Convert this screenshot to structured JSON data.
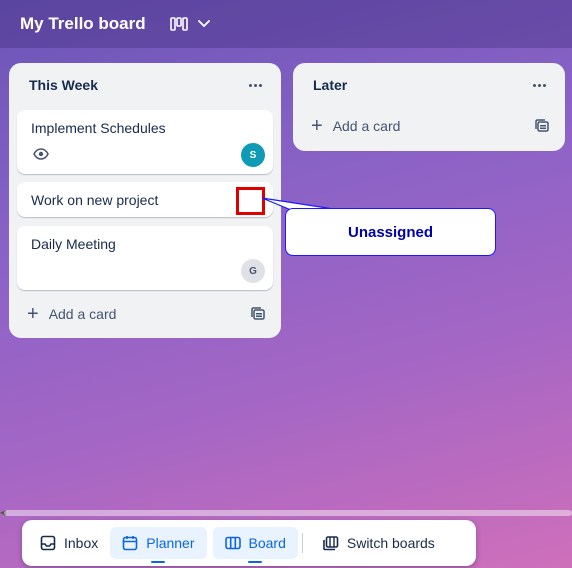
{
  "board": {
    "title": "My Trello board",
    "view_icon": "board-view-icon",
    "dropdown_icon": "chevron-down-icon"
  },
  "lists": [
    {
      "title": "This Week",
      "menu_icon": "ellipsis-icon",
      "cards": [
        {
          "title": "Implement Schedules",
          "badge_icon": "eye-icon",
          "member_initial": "S",
          "member_color": "#0f9ab5"
        },
        {
          "title": "Work on new project"
        },
        {
          "title": "Daily Meeting",
          "member_initial": "G",
          "member_color": "#dfe1e6"
        }
      ],
      "add_card_label": "Add a card",
      "template_icon": "card-template-icon"
    },
    {
      "title": "Later",
      "menu_icon": "ellipsis-icon",
      "add_card_label": "Add a card",
      "template_icon": "card-template-icon"
    }
  ],
  "annotation": {
    "callout_text": "Unassigned",
    "highlight_color": "#e00000"
  },
  "bottom_nav": {
    "inbox": "Inbox",
    "planner": "Planner",
    "board": "Board",
    "switch_boards": "Switch boards"
  },
  "colors": {
    "accent": "#0c66e4",
    "list_bg": "#f1f2f4"
  }
}
